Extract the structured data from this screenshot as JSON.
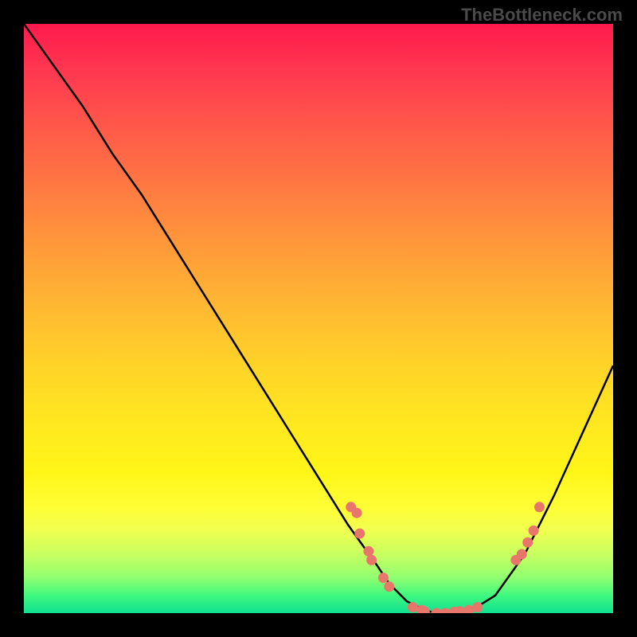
{
  "watermark": "TheBottleneck.com",
  "chart_data": {
    "type": "line",
    "title": "",
    "xlabel": "",
    "ylabel": "",
    "xlim": [
      0,
      100
    ],
    "ylim": [
      0,
      100
    ],
    "series": [
      {
        "name": "curve",
        "x": [
          0,
          5,
          10,
          15,
          20,
          25,
          30,
          35,
          40,
          45,
          50,
          55,
          60,
          62,
          65,
          68,
          70,
          73,
          76,
          80,
          85,
          90,
          95,
          100
        ],
        "y": [
          100,
          93,
          86,
          78,
          71,
          63,
          55,
          47,
          39,
          31,
          23,
          15,
          8,
          5,
          2,
          0.5,
          0,
          0,
          0.5,
          3,
          10,
          20,
          31,
          42
        ]
      }
    ],
    "points": [
      {
        "x": 55.5,
        "y": 18
      },
      {
        "x": 56.5,
        "y": 17
      },
      {
        "x": 57,
        "y": 13.5
      },
      {
        "x": 58.5,
        "y": 10.5
      },
      {
        "x": 59,
        "y": 9
      },
      {
        "x": 61,
        "y": 6
      },
      {
        "x": 62,
        "y": 4.5
      },
      {
        "x": 66,
        "y": 1
      },
      {
        "x": 67.5,
        "y": 0.5
      },
      {
        "x": 68,
        "y": 0.3
      },
      {
        "x": 70,
        "y": 0
      },
      {
        "x": 71.5,
        "y": 0
      },
      {
        "x": 73,
        "y": 0.2
      },
      {
        "x": 74,
        "y": 0.3
      },
      {
        "x": 75.5,
        "y": 0.5
      },
      {
        "x": 77,
        "y": 1
      },
      {
        "x": 83.5,
        "y": 9
      },
      {
        "x": 84.5,
        "y": 10
      },
      {
        "x": 85.5,
        "y": 12
      },
      {
        "x": 86.5,
        "y": 14
      },
      {
        "x": 87.5,
        "y": 18
      }
    ],
    "point_color": "#e8766a",
    "curve_color": "#000000"
  }
}
